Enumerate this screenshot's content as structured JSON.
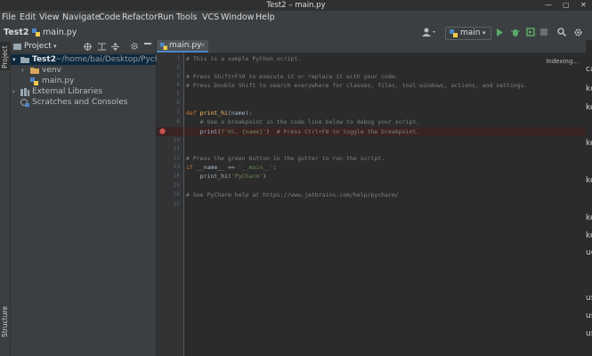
{
  "window": {
    "title": "Test2 – main.py"
  },
  "menu": [
    "File",
    "Edit",
    "View",
    "Navigate",
    "Code",
    "Refactor",
    "Run",
    "Tools",
    "VCS",
    "Window",
    "Help"
  ],
  "nav": {
    "project": "Test2",
    "file": "main.py",
    "branch": "main"
  },
  "sidebar": {
    "project_tab": "Project",
    "structure_tab": "Structure",
    "panel_title": "Project"
  },
  "tree": {
    "root_name": "Test2",
    "root_path": "~/home/bai/Desktop/Pycharm",
    "venv": "venv",
    "main": "main.py",
    "external": "External Libraries",
    "scratches": "Scratches and Consoles"
  },
  "editor": {
    "tab": "main.py",
    "status": "Indexing...",
    "line_numbers": [
      "1",
      "2",
      "3",
      "4",
      "5",
      "6",
      "7",
      "8",
      "9",
      "10",
      "11",
      "12",
      "13",
      "14",
      "15",
      "16",
      "17"
    ],
    "code": {
      "l1": "# This is a sample Python script.",
      "l3": "# Press Shift+F10 to execute it or replace it with your code.",
      "l4": "# Press Double Shift to search everywhere for classes, files, tool windows, actions, and settings.",
      "l7_kw": "def ",
      "l7_fn": "print_hi",
      "l7_rest": "(name):",
      "l8": "    # Use a breakpoint in the code line below to debug your script.",
      "l9_fn": "    print",
      "l9_open": "(",
      "l9_str": "f'Hi, {name}'",
      "l9_close": ")  ",
      "l9_cm": "# Press Ctrl+F8 to toggle the breakpoint.",
      "l12": "# Press the green button in the gutter to run the script.",
      "l13_kw": "if ",
      "l13_name": "__name__ == ",
      "l13_str": "'__main__'",
      "l13_end": ":",
      "l14_fn": "    print_hi",
      "l14_open": "(",
      "l14_str": "'PyCharm'",
      "l14_close": ")",
      "l16": "# See PyCharm help at https://www.jetbrains.com/help/pycharm/"
    }
  },
  "right_strip": [
    "cat",
    "kc",
    "key",
    "key",
    "key",
    "key",
    "key",
    "uc",
    "use",
    "use",
    "use"
  ],
  "colors": {
    "accent_run": "#59a869",
    "breakpoint": "#c75450",
    "folder": "#d8a657",
    "python_blue": "#4a86c7"
  }
}
